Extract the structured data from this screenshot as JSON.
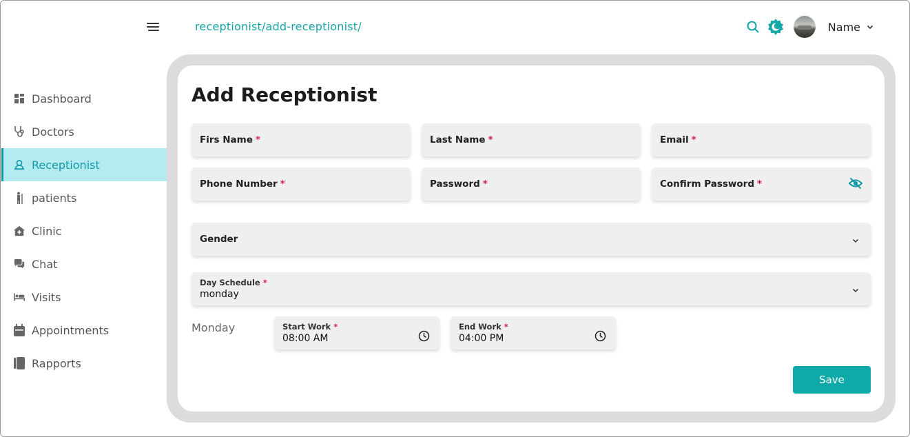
{
  "header": {
    "breadcrumb": "receptionist/add-receptionist/",
    "user_name": "Name",
    "accent_color": "#16a6a6"
  },
  "sidebar": {
    "items": [
      {
        "label": "Dashboard",
        "icon": "grid-icon"
      },
      {
        "label": "Doctors",
        "icon": "stethoscope-icon"
      },
      {
        "label": "Receptionist",
        "icon": "receptionist-icon",
        "active": true
      },
      {
        "label": "patients",
        "icon": "patient-icon"
      },
      {
        "label": "Clinic",
        "icon": "house-medical-icon"
      },
      {
        "label": "Chat",
        "icon": "chat-icon"
      },
      {
        "label": "Visits",
        "icon": "bed-icon"
      },
      {
        "label": "Appointments",
        "icon": "calendar-icon"
      },
      {
        "label": "Rapports",
        "icon": "book-icon"
      }
    ],
    "active_color": "#b4ebf0"
  },
  "form": {
    "title": "Add Receptionist",
    "first_name_label": "Firs Name",
    "last_name_label": "Last Name",
    "email_label": "Email",
    "phone_label": "Phone Number",
    "password_label": "Password",
    "confirm_password_label": "Confirm Password",
    "required_mark": "*",
    "gender_label": "Gender",
    "day_schedule_label": "Day Schedule",
    "day_schedule_value": "monday",
    "day_label": "Monday",
    "start_work_label": "Start Work",
    "start_work_value": "08:00 AM",
    "end_work_label": "End Work",
    "end_work_value": "04:00 PM",
    "save_label": "Save"
  }
}
